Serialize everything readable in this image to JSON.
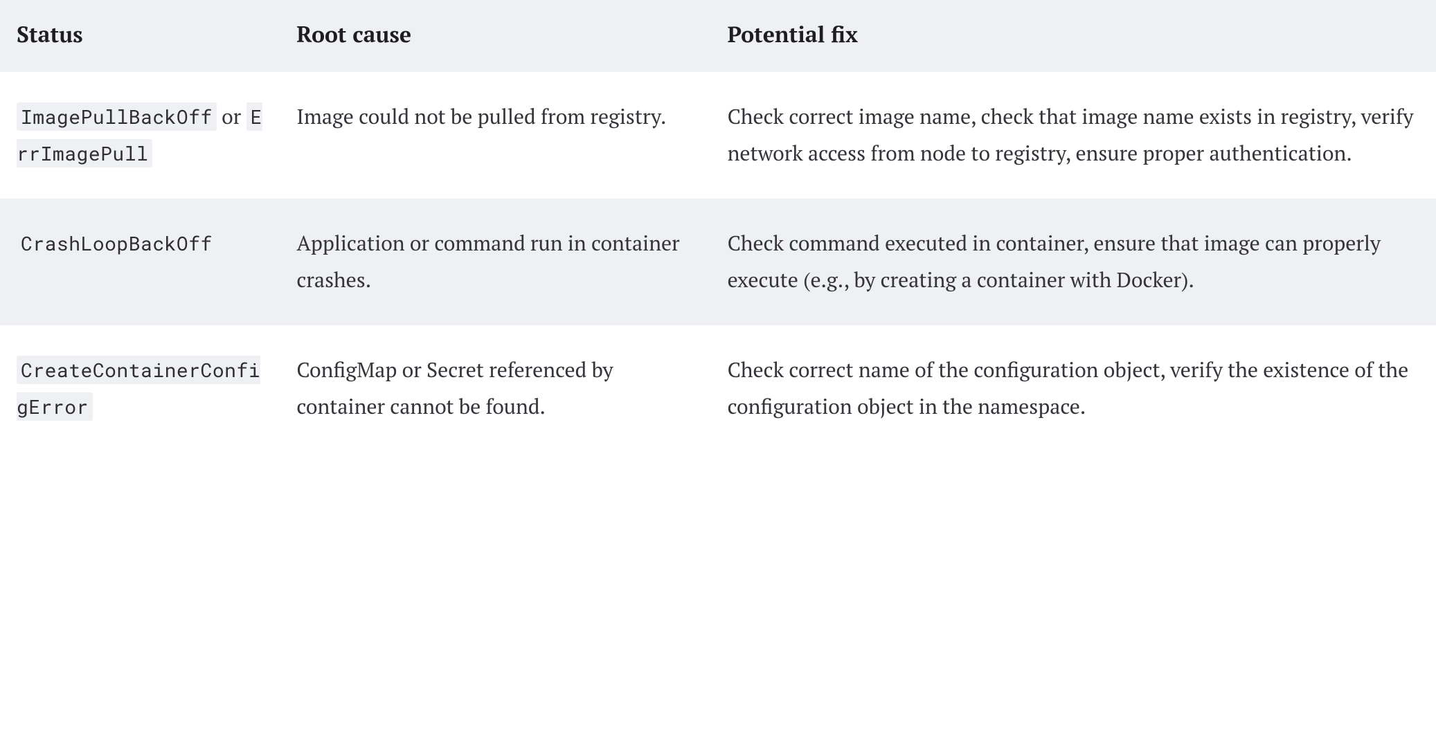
{
  "headers": {
    "status": "Status",
    "root_cause": "Root cause",
    "potential_fix": "Potential fix"
  },
  "joiner": " or ",
  "rows": [
    {
      "status_codes": [
        "ImagePullBackOff",
        "ErrImagePull"
      ],
      "root_cause": "Image could not be pulled from registry.",
      "potential_fix": "Check correct image name, check that image name exists in registry, verify network access from node to registry, ensure proper authentication."
    },
    {
      "status_codes": [
        "CrashLoopBackOff"
      ],
      "root_cause": "Application or command run in container crashes.",
      "potential_fix": "Check command executed in container, ensure that image can properly execute (e.g., by creating a container with Docker)."
    },
    {
      "status_codes": [
        "CreateContainerConfigError"
      ],
      "root_cause": "ConfigMap or Secret refer­enced by container cannot be found.",
      "potential_fix": "Check correct name of the configuration object, verify the existence of the configuration object in the namespace."
    }
  ]
}
